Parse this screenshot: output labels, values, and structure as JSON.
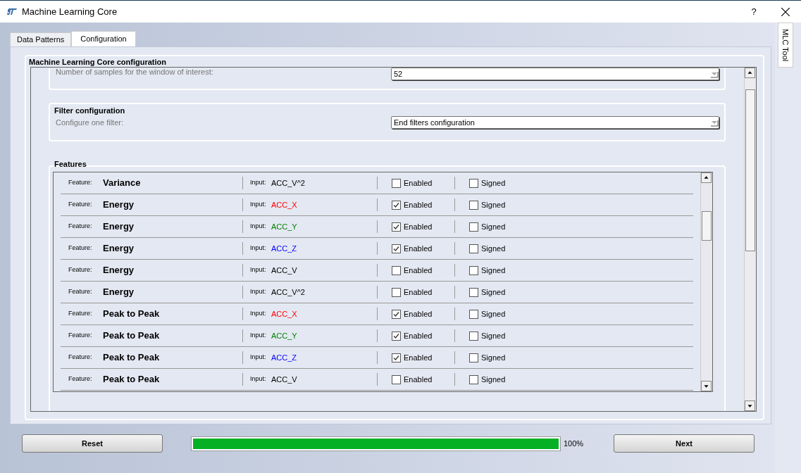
{
  "window": {
    "title": "Machine Learning Core",
    "help": "?"
  },
  "tabs": [
    {
      "label": "Data Patterns",
      "selected": false
    },
    {
      "label": "Configuration",
      "selected": true
    }
  ],
  "side_tab": {
    "label": "MLC Tool"
  },
  "config": {
    "title": "Machine Learning Core configuration",
    "window_samples": {
      "label": "Number of samples for the window of interest:",
      "value": "52"
    },
    "filter": {
      "title": "Filter configuration",
      "label": "Configure one filter:",
      "value": "End filters configuration"
    },
    "features": {
      "title": "Features",
      "rows": [
        {
          "feature_label": "Feature:",
          "feature": "Variance",
          "input_label": "Input:",
          "input": "ACC_V^2",
          "color": "#000000",
          "enabled_label": "Enabled",
          "enabled": false,
          "signed_label": "Signed",
          "signed": false
        },
        {
          "feature_label": "Feature:",
          "feature": "Energy",
          "input_label": "Input:",
          "input": "ACC_X",
          "color": "#ff0000",
          "enabled_label": "Enabled",
          "enabled": true,
          "signed_label": "Signed",
          "signed": false
        },
        {
          "feature_label": "Feature:",
          "feature": "Energy",
          "input_label": "Input:",
          "input": "ACC_Y",
          "color": "#008000",
          "enabled_label": "Enabled",
          "enabled": true,
          "signed_label": "Signed",
          "signed": false
        },
        {
          "feature_label": "Feature:",
          "feature": "Energy",
          "input_label": "Input:",
          "input": "ACC_Z",
          "color": "#0000ff",
          "enabled_label": "Enabled",
          "enabled": true,
          "signed_label": "Signed",
          "signed": false
        },
        {
          "feature_label": "Feature:",
          "feature": "Energy",
          "input_label": "Input:",
          "input": "ACC_V",
          "color": "#000000",
          "enabled_label": "Enabled",
          "enabled": false,
          "signed_label": "Signed",
          "signed": false
        },
        {
          "feature_label": "Feature:",
          "feature": "Energy",
          "input_label": "Input:",
          "input": "ACC_V^2",
          "color": "#000000",
          "enabled_label": "Enabled",
          "enabled": false,
          "signed_label": "Signed",
          "signed": false
        },
        {
          "feature_label": "Feature:",
          "feature": "Peak to Peak",
          "input_label": "Input:",
          "input": "ACC_X",
          "color": "#ff0000",
          "enabled_label": "Enabled",
          "enabled": true,
          "signed_label": "Signed",
          "signed": false
        },
        {
          "feature_label": "Feature:",
          "feature": "Peak to Peak",
          "input_label": "Input:",
          "input": "ACC_Y",
          "color": "#008000",
          "enabled_label": "Enabled",
          "enabled": true,
          "signed_label": "Signed",
          "signed": false
        },
        {
          "feature_label": "Feature:",
          "feature": "Peak to Peak",
          "input_label": "Input:",
          "input": "ACC_Z",
          "color": "#0000ff",
          "enabled_label": "Enabled",
          "enabled": true,
          "signed_label": "Signed",
          "signed": false
        },
        {
          "feature_label": "Feature:",
          "feature": "Peak to Peak",
          "input_label": "Input:",
          "input": "ACC_V",
          "color": "#000000",
          "enabled_label": "Enabled",
          "enabled": false,
          "signed_label": "Signed",
          "signed": false
        }
      ]
    }
  },
  "footer": {
    "reset": "Reset",
    "progress": {
      "level": 1.0,
      "reading": "100%"
    },
    "next": "Next"
  }
}
